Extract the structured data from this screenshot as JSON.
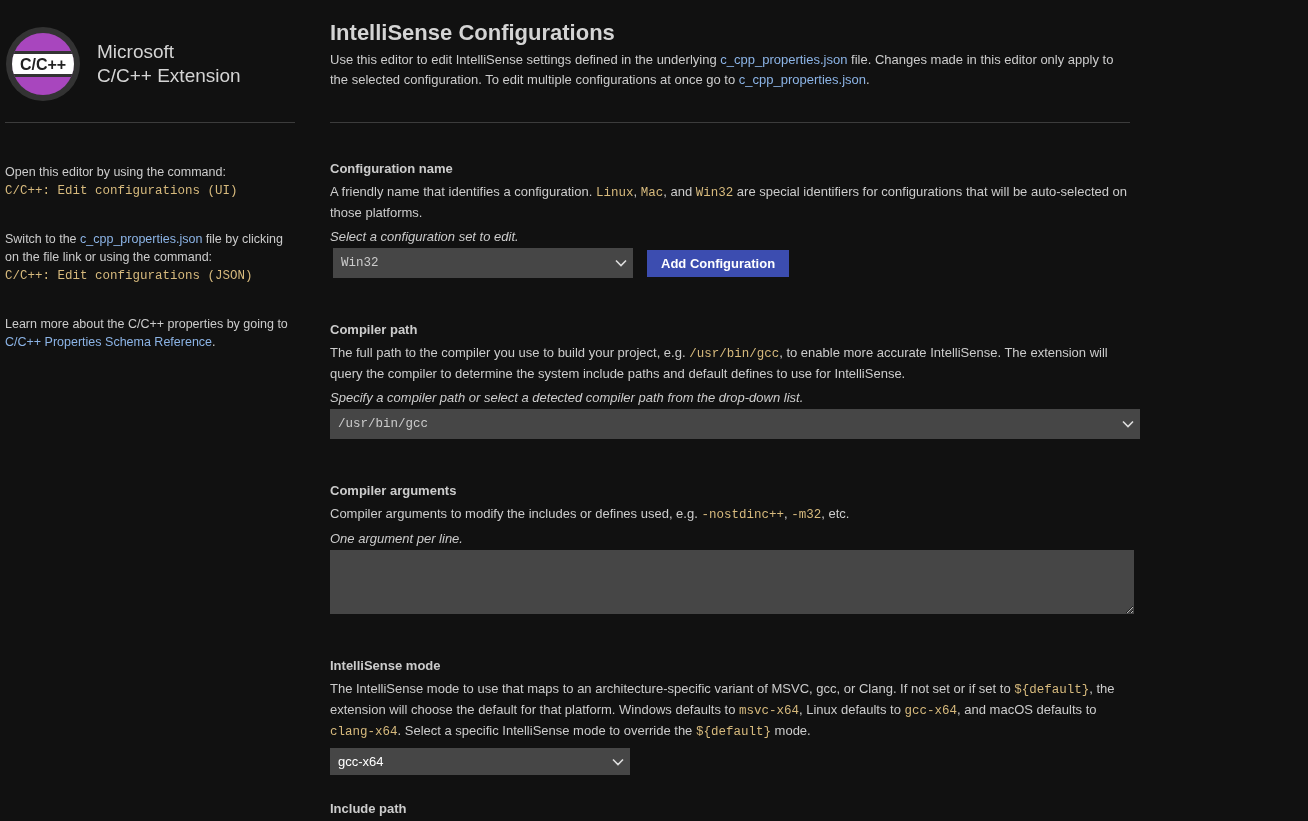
{
  "sidebar": {
    "logo_text": "C/C++",
    "title_lines": [
      "Microsoft",
      "C/C++ Extension"
    ],
    "notes": [
      [
        {
          "kind": "text",
          "text": "Open this editor by using the command:"
        },
        {
          "kind": "break"
        },
        {
          "kind": "code",
          "text": "C/C++: Edit configurations (UI)"
        }
      ],
      [
        {
          "kind": "text",
          "text": "Switch to the "
        },
        {
          "kind": "link",
          "text": "c_cpp_properties.json"
        },
        {
          "kind": "text",
          "text": " file by clicking on the file link or using the command:"
        },
        {
          "kind": "break"
        },
        {
          "kind": "code",
          "text": "C/C++: Edit configurations (JSON)"
        }
      ],
      [
        {
          "kind": "text",
          "text": "Learn more about the C/C++ properties by going to "
        },
        {
          "kind": "link",
          "text": "C/C++ Properties Schema Reference"
        },
        {
          "kind": "text",
          "text": "."
        }
      ]
    ]
  },
  "header": {
    "title": "IntelliSense Configurations",
    "description": [
      {
        "kind": "text",
        "text": "Use this editor to edit IntelliSense settings defined in the underlying "
      },
      {
        "kind": "link",
        "text": "c_cpp_properties.json"
      },
      {
        "kind": "text",
        "text": " file. Changes made in this editor only apply to the selected configuration. To edit multiple configurations at once go to "
      },
      {
        "kind": "link",
        "text": "c_cpp_properties.json"
      },
      {
        "kind": "text",
        "text": "."
      }
    ]
  },
  "sections": [
    {
      "kind": "config",
      "title": "Configuration name",
      "description": [
        {
          "kind": "text",
          "text": "A friendly name that identifies a configuration. "
        },
        {
          "kind": "code",
          "text": "Linux"
        },
        {
          "kind": "text",
          "text": ", "
        },
        {
          "kind": "code",
          "text": "Mac"
        },
        {
          "kind": "text",
          "text": ", and "
        },
        {
          "kind": "code",
          "text": "Win32"
        },
        {
          "kind": "text",
          "text": " are special identifiers for configurations that will be auto-selected on those platforms."
        }
      ],
      "hint": "Select a configuration set to edit.",
      "value": "Win32",
      "button": "Add Configuration"
    },
    {
      "kind": "wide-select",
      "title": "Compiler path",
      "description": [
        {
          "kind": "text",
          "text": "The full path to the compiler you use to build your project, e.g. "
        },
        {
          "kind": "code",
          "text": "/usr/bin/gcc"
        },
        {
          "kind": "text",
          "text": ", to enable more accurate IntelliSense. The extension will query the compiler to determine the system include paths and default defines to use for IntelliSense."
        }
      ],
      "hint": "Specify a compiler path or select a detected compiler path from the drop-down list.",
      "value": "/usr/bin/gcc"
    },
    {
      "kind": "textarea",
      "title": "Compiler arguments",
      "description": [
        {
          "kind": "text",
          "text": "Compiler arguments to modify the includes or defines used, e.g. "
        },
        {
          "kind": "code",
          "text": "-nostdinc++"
        },
        {
          "kind": "text",
          "text": ", "
        },
        {
          "kind": "code",
          "text": "-m32"
        },
        {
          "kind": "text",
          "text": ", etc."
        }
      ],
      "hint": "One argument per line."
    },
    {
      "kind": "select",
      "title": "IntelliSense mode",
      "description": [
        {
          "kind": "text",
          "text": "The IntelliSense mode to use that maps to an architecture-specific variant of MSVC, gcc, or Clang. If not set or if set to "
        },
        {
          "kind": "code",
          "text": "${default}"
        },
        {
          "kind": "text",
          "text": ", the extension will choose the default for that platform. Windows defaults to "
        },
        {
          "kind": "code",
          "text": "msvc-x64"
        },
        {
          "kind": "text",
          "text": ", Linux defaults to "
        },
        {
          "kind": "code",
          "text": "gcc-x64"
        },
        {
          "kind": "text",
          "text": ", and macOS defaults to "
        },
        {
          "kind": "code",
          "text": "clang-x64"
        },
        {
          "kind": "text",
          "text": ". Select a specific IntelliSense mode to override the "
        },
        {
          "kind": "code",
          "text": "${default}"
        },
        {
          "kind": "text",
          "text": " mode."
        }
      ],
      "value": "gcc-x64"
    },
    {
      "kind": "heading-only",
      "title": "Include path"
    }
  ]
}
